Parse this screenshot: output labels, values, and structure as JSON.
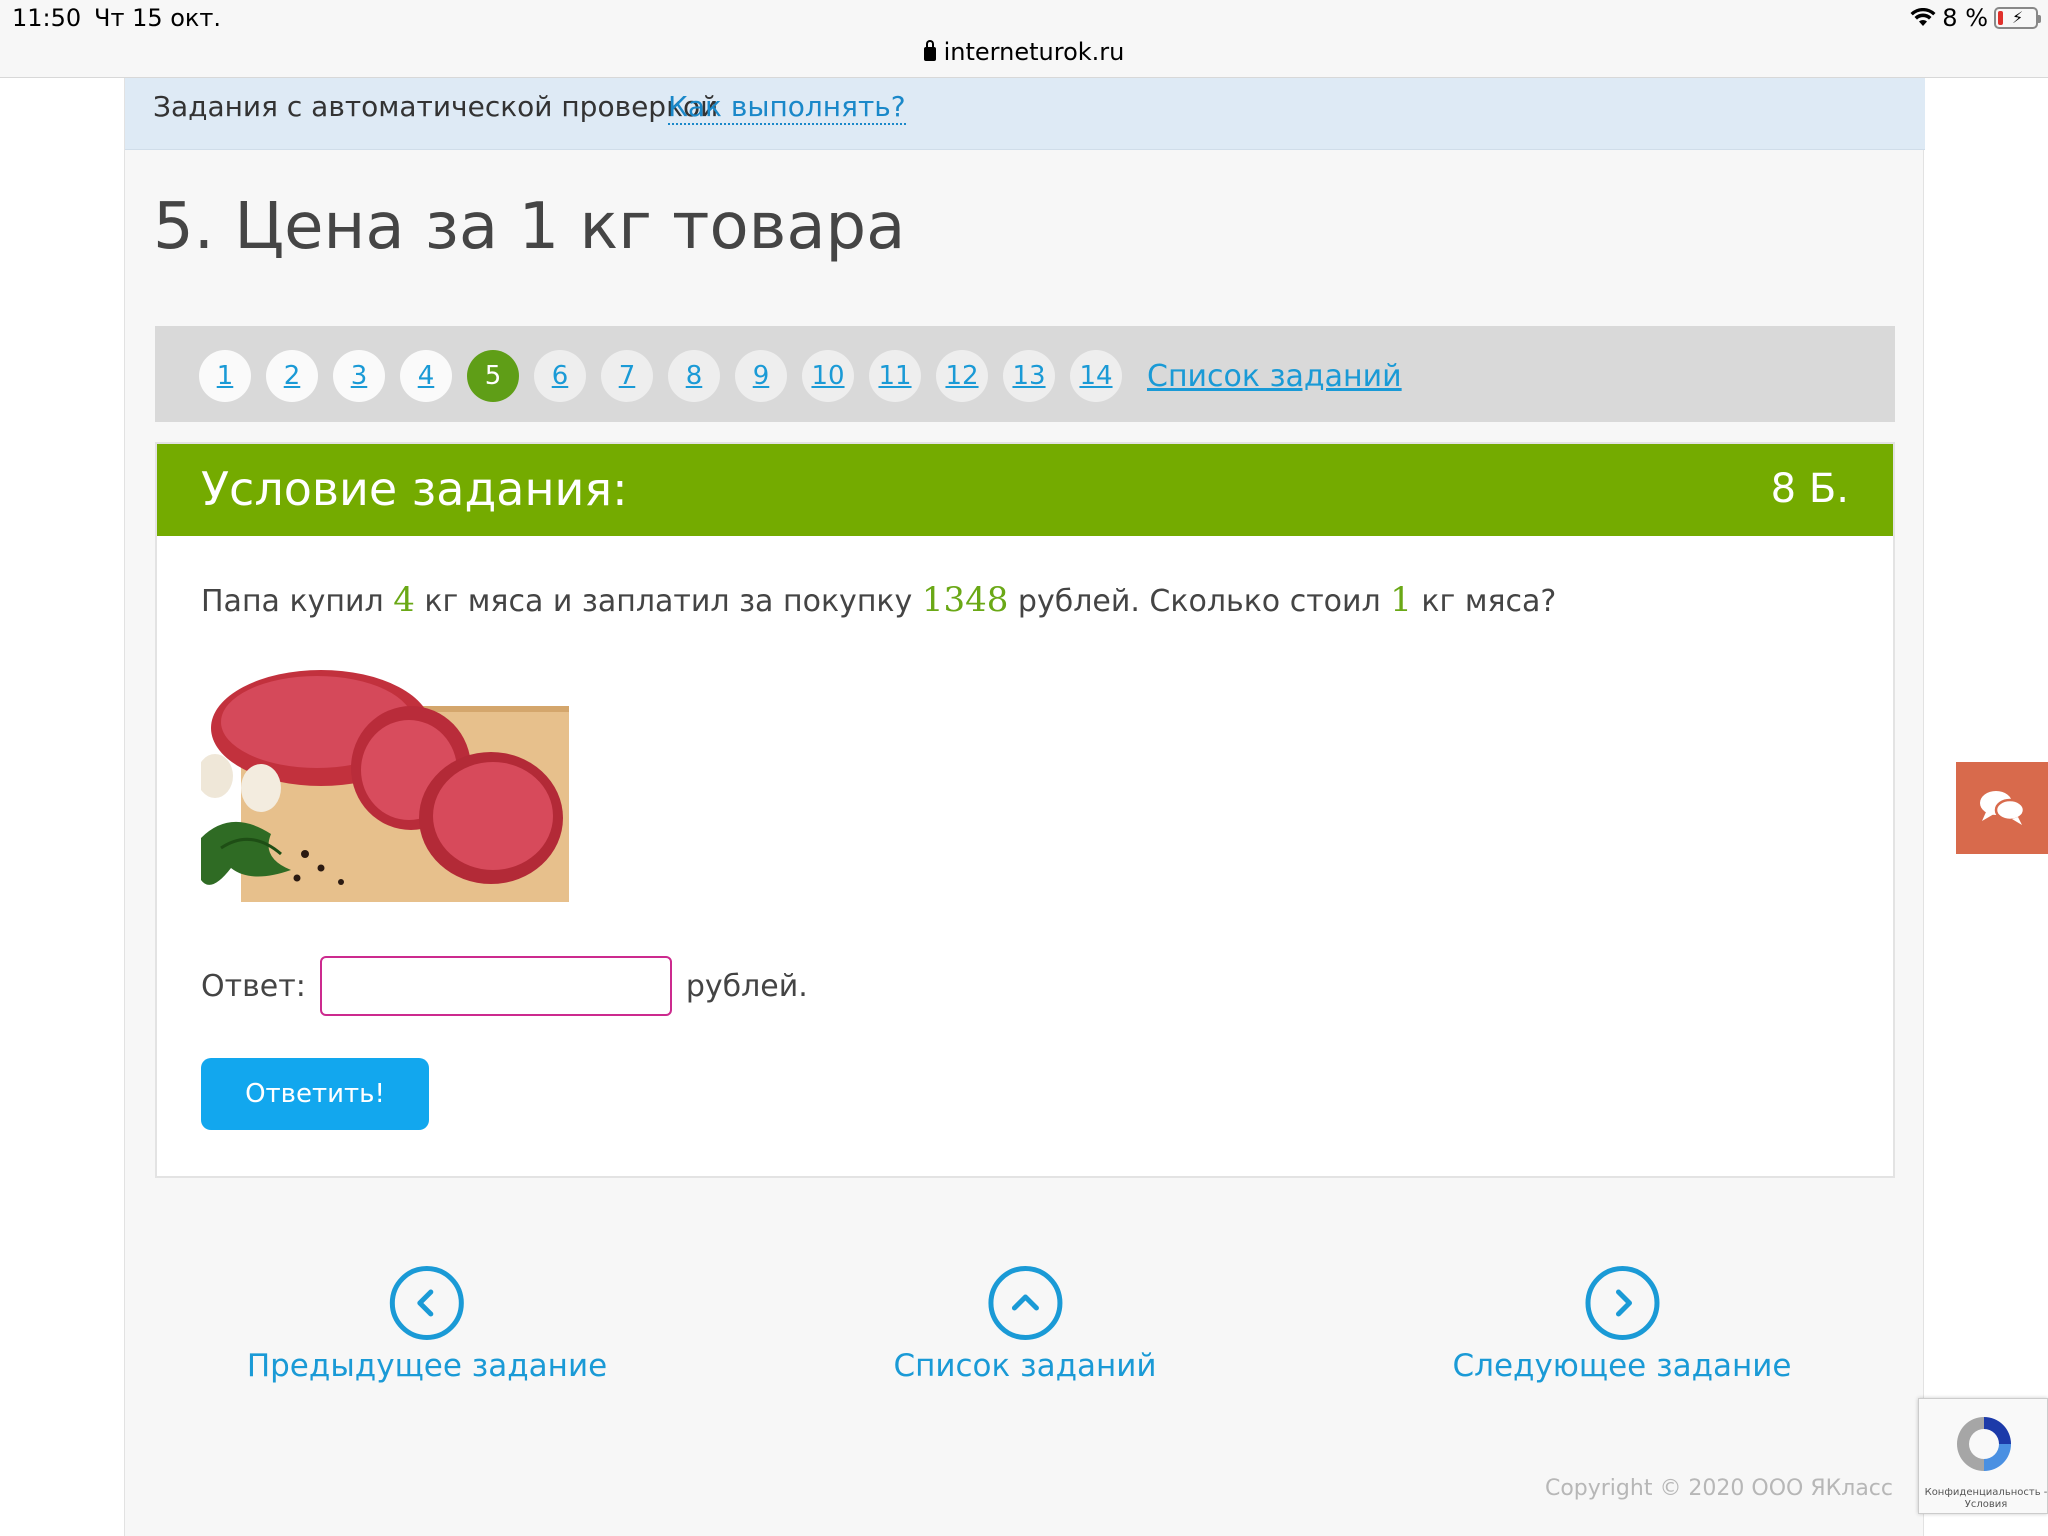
{
  "status_bar": {
    "time": "11:50",
    "date": "Чт 15 окт.",
    "battery": "8 %",
    "url": "interneturok.ru"
  },
  "topbar": {
    "text": "Задания с автоматической проверкой",
    "help_link": "Как выполнять?"
  },
  "title": "5. Цена за 1 кг товара",
  "task_nav": {
    "items": [
      "1",
      "2",
      "3",
      "4",
      "5",
      "6",
      "7",
      "8",
      "9",
      "10",
      "11",
      "12",
      "13",
      "14"
    ],
    "active": "5",
    "list_link": "Список заданий"
  },
  "task": {
    "header": "Условие задания:",
    "points": "8 Б.",
    "question": {
      "p1": "Папа купил ",
      "n1": "4",
      "p2": " кг мяса и заплатил за покупку ",
      "n2": "1348",
      "p3": " рублей. Сколько стоил ",
      "n3": "1",
      "p4": " кг мяса?"
    },
    "answer_label": "Ответ:",
    "answer_value": "",
    "answer_unit": "рублей.",
    "submit_label": "Ответить!"
  },
  "bottom_nav": {
    "prev": "Предыдущее задание",
    "list": "Список заданий",
    "next": "Следующее задание"
  },
  "copyright": "Copyright © 2020 ООО ЯКласс",
  "recaptcha": "Конфиденциальность - Условия",
  "colors": {
    "header_green": "#74ab00",
    "active_green": "#5f9e17",
    "link_blue": "#1a9ad6",
    "button_blue": "#12a7ee",
    "input_border": "#cc2a8e",
    "chat_orange": "#d86a4c"
  },
  "icons": [
    "lock-icon",
    "wifi-icon",
    "battery-icon",
    "chevron-left-icon",
    "chevron-up-icon",
    "chevron-right-icon",
    "chat-icon",
    "recaptcha-icon"
  ]
}
